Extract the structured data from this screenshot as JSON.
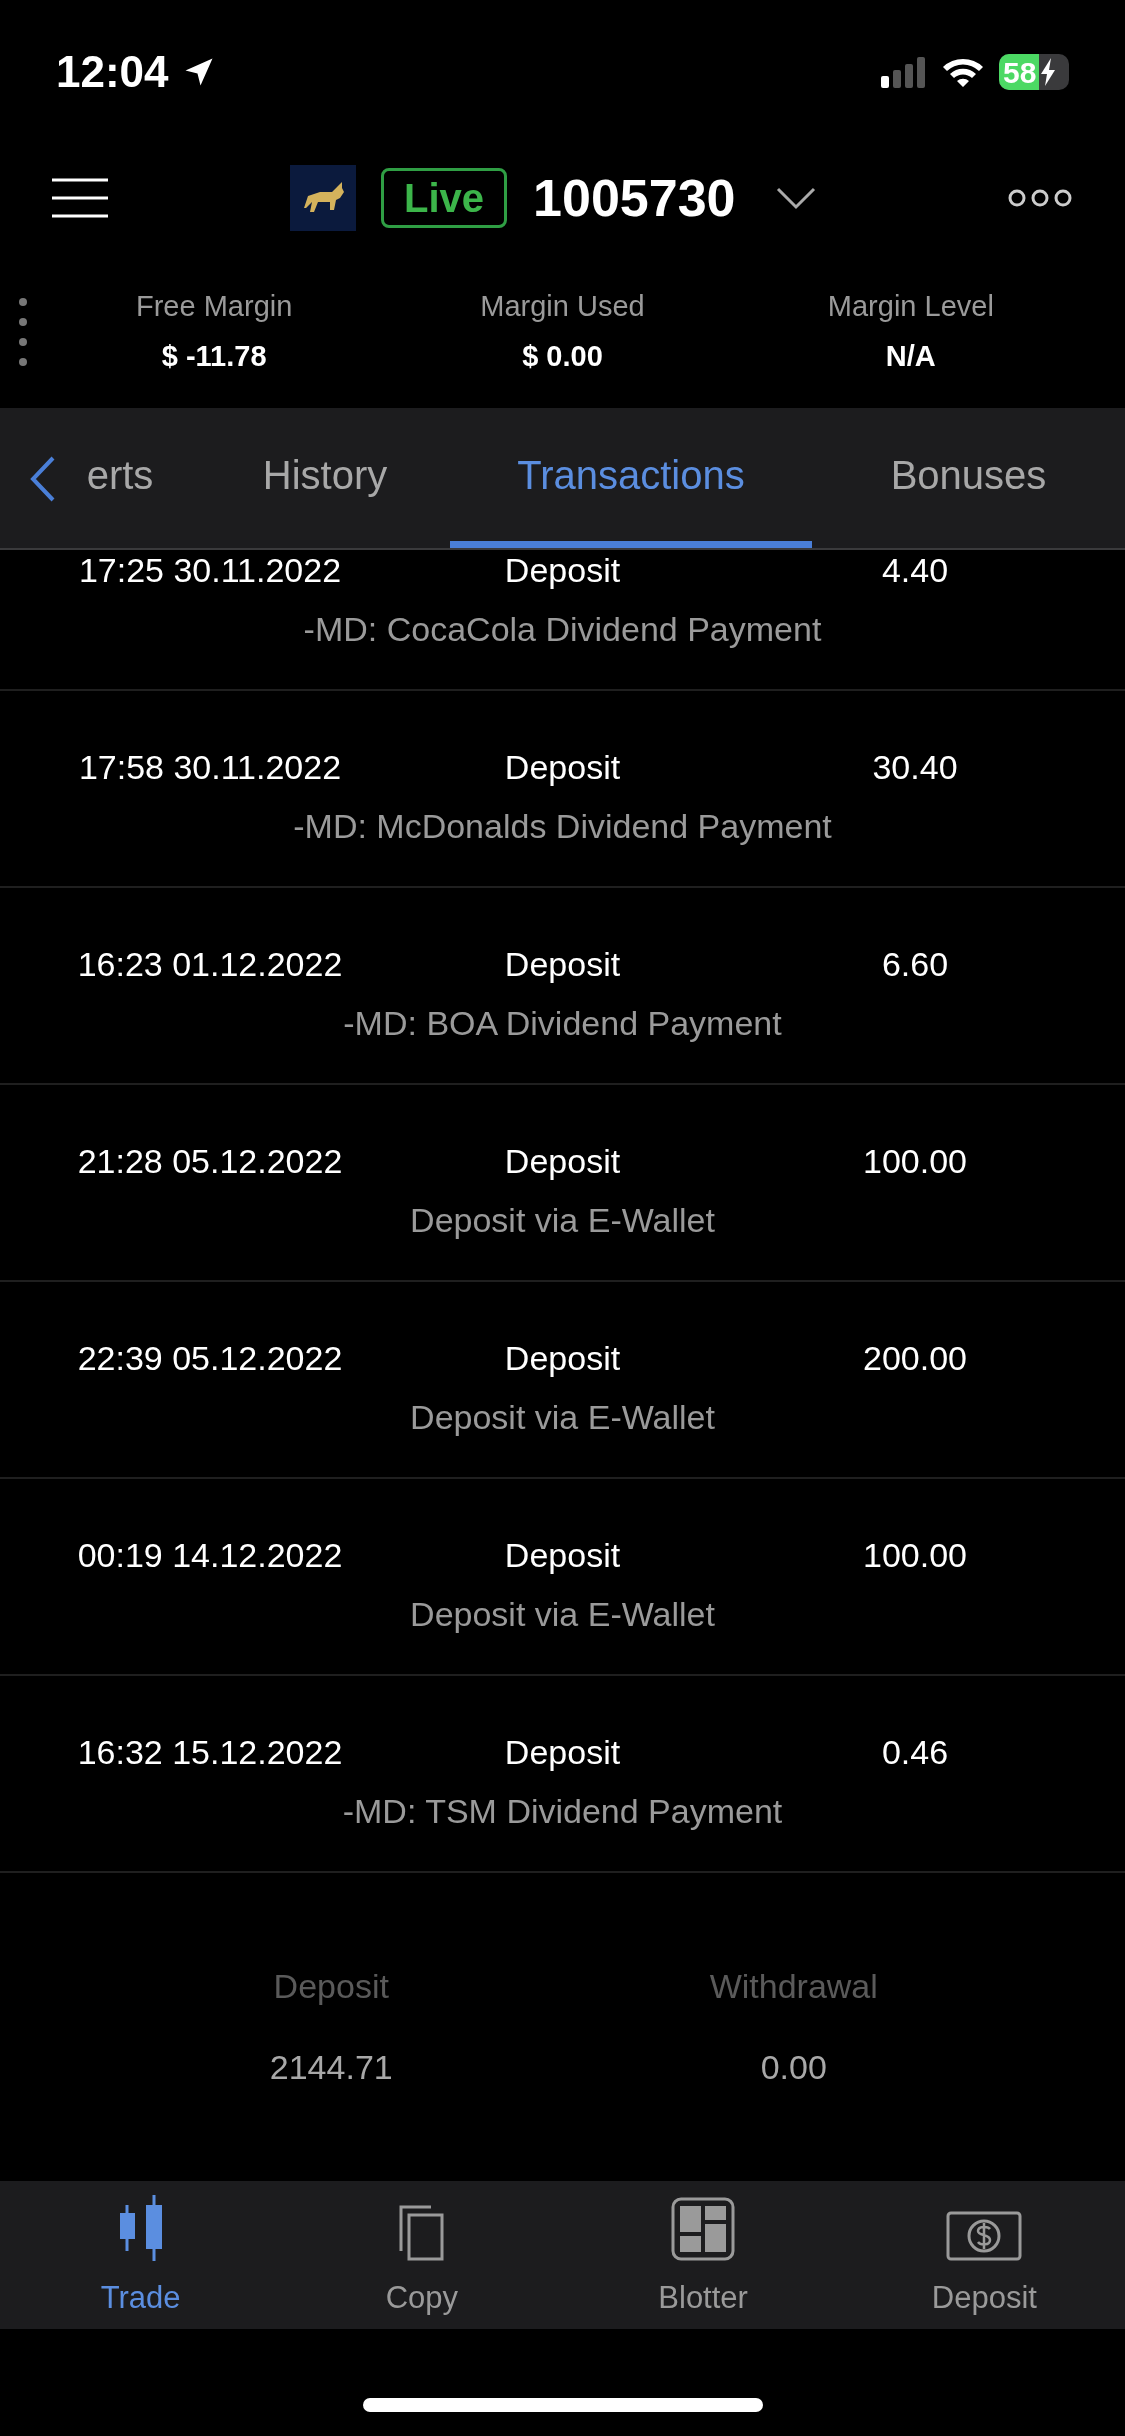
{
  "status_bar": {
    "time": "12:04",
    "battery": "58"
  },
  "header": {
    "badge": "Live",
    "account": "1005730"
  },
  "margins": [
    {
      "label": "Free Margin",
      "value": "$ -11.78"
    },
    {
      "label": "Margin Used",
      "value": "$ 0.00"
    },
    {
      "label": "Margin Level",
      "value": "N/A"
    }
  ],
  "tabs": [
    {
      "label": "erts",
      "selected": false
    },
    {
      "label": "History",
      "selected": false
    },
    {
      "label": "Transactions",
      "selected": true
    },
    {
      "label": "Bonuses",
      "selected": false
    }
  ],
  "transactions": [
    {
      "time": "17:25 30.11.2022",
      "type": "Deposit",
      "amount": "4.40",
      "description": "-MD: CocaCola Dividend Payment"
    },
    {
      "time": "17:58 30.11.2022",
      "type": "Deposit",
      "amount": "30.40",
      "description": "-MD: McDonalds Dividend Payment"
    },
    {
      "time": "16:23 01.12.2022",
      "type": "Deposit",
      "amount": "6.60",
      "description": "-MD: BOA Dividend Payment"
    },
    {
      "time": "21:28 05.12.2022",
      "type": "Deposit",
      "amount": "100.00",
      "description": "Deposit via E-Wallet"
    },
    {
      "time": "22:39 05.12.2022",
      "type": "Deposit",
      "amount": "200.00",
      "description": "Deposit via E-Wallet"
    },
    {
      "time": "00:19 14.12.2022",
      "type": "Deposit",
      "amount": "100.00",
      "description": "Deposit via E-Wallet"
    },
    {
      "time": "16:32 15.12.2022",
      "type": "Deposit",
      "amount": "0.46",
      "description": "-MD: TSM Dividend Payment"
    }
  ],
  "totals": [
    {
      "label": "Deposit",
      "value": "2144.71"
    },
    {
      "label": "Withdrawal",
      "value": "0.00"
    }
  ],
  "nav": [
    {
      "kind": "trade",
      "label": "Trade",
      "selected": true
    },
    {
      "kind": "copy",
      "label": "Copy",
      "selected": false
    },
    {
      "kind": "blotter",
      "label": "Blotter",
      "selected": false
    },
    {
      "kind": "deposit",
      "label": "Deposit",
      "selected": false
    }
  ]
}
